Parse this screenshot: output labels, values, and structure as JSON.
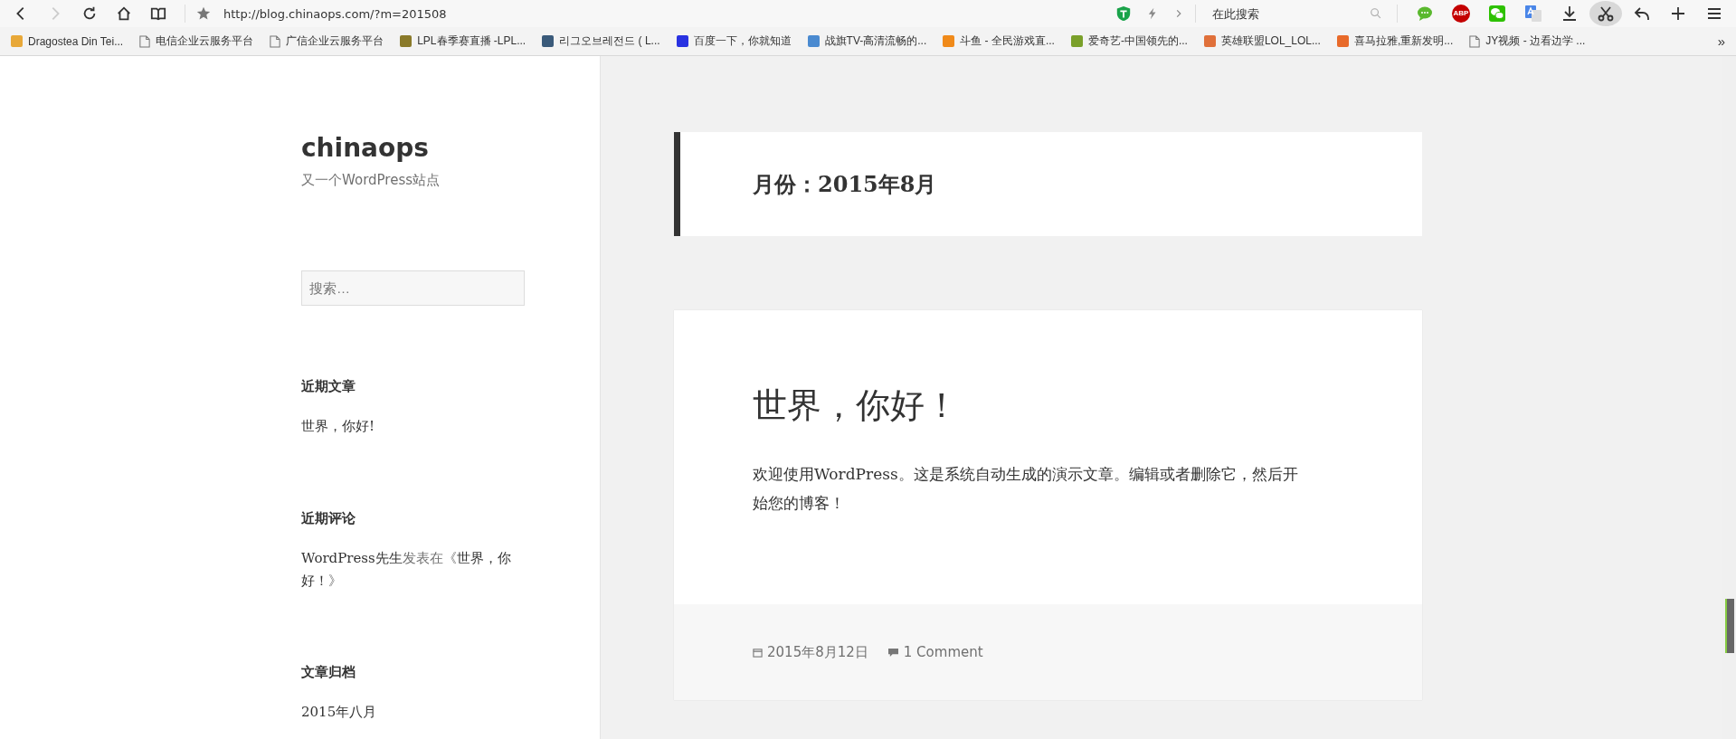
{
  "toolbar": {
    "nav": [
      {
        "kind": "back",
        "disabled": false
      },
      {
        "kind": "forward",
        "disabled": true
      },
      {
        "kind": "reload",
        "disabled": false
      },
      {
        "kind": "home",
        "disabled": false
      },
      {
        "kind": "reader",
        "disabled": false
      }
    ],
    "url": "http://blog.chinaops.com/?m=201508",
    "search": {
      "placeholder": "在此搜索"
    },
    "extensions": [
      {
        "kind": "chat",
        "active": false
      },
      {
        "kind": "abp",
        "label": "ABP",
        "active": false
      },
      {
        "kind": "wechat",
        "active": false
      },
      {
        "kind": "translate",
        "active": false
      },
      {
        "kind": "download",
        "active": false
      },
      {
        "kind": "scissors",
        "active": true
      },
      {
        "kind": "undo",
        "active": false
      },
      {
        "kind": "plus",
        "active": false
      },
      {
        "kind": "menu",
        "active": false
      }
    ]
  },
  "bookmarks": {
    "items": [
      {
        "label": "Dragostea Din Tei...",
        "kind": "logo",
        "color": "#e8a838"
      },
      {
        "label": "电信企业云服务平台",
        "kind": "page"
      },
      {
        "label": "广信企业云服务平台",
        "kind": "page"
      },
      {
        "label": "LPL春季赛直播 -LPL...",
        "kind": "logo",
        "color": "#8a7a2a"
      },
      {
        "label": "리그오브레전드 ( L...",
        "kind": "logo",
        "color": "#3a5a7a"
      },
      {
        "label": "百度一下，你就知道",
        "kind": "logo",
        "color": "#2932e1"
      },
      {
        "label": "战旗TV-高清流畅的...",
        "kind": "logo",
        "color": "#4a8ad0"
      },
      {
        "label": "斗鱼 - 全民游戏直...",
        "kind": "logo",
        "color": "#f08a1a"
      },
      {
        "label": "爱奇艺-中国领先的...",
        "kind": "logo",
        "color": "#7aa02a"
      },
      {
        "label": "英雄联盟LOL_LOL...",
        "kind": "logo",
        "color": "#e0703a"
      },
      {
        "label": "喜马拉雅,重新发明...",
        "kind": "logo",
        "color": "#e86a2a"
      },
      {
        "label": "JY视频 - 边看边学 ...",
        "kind": "page"
      }
    ],
    "overflow": "»"
  },
  "sidebar": {
    "site_title": "chinaops",
    "tagline": "又一个WordPress站点",
    "search": {
      "placeholder": "搜索…"
    },
    "widgets": [
      {
        "title": "近期文章",
        "items": [
          {
            "kind": "link",
            "text": "世界，你好!"
          }
        ]
      },
      {
        "title": "近期评论",
        "items": [
          {
            "kind": "comment",
            "author": "WordPress先生",
            "middle": "发表在《",
            "post": "世界，你好！",
            "end": "》"
          }
        ]
      },
      {
        "title": "文章归档",
        "items": [
          {
            "kind": "link",
            "text": "2015年八月"
          }
        ]
      }
    ]
  },
  "main": {
    "archive_title": "月份：2015年8月",
    "post": {
      "title": "世界，你好！",
      "body": "欢迎使用WordPress。这是系统自动生成的演示文章。编辑或者删除它，然后开始您的博客！",
      "date": "2015年8月12日",
      "comments": "1 Comment"
    }
  }
}
